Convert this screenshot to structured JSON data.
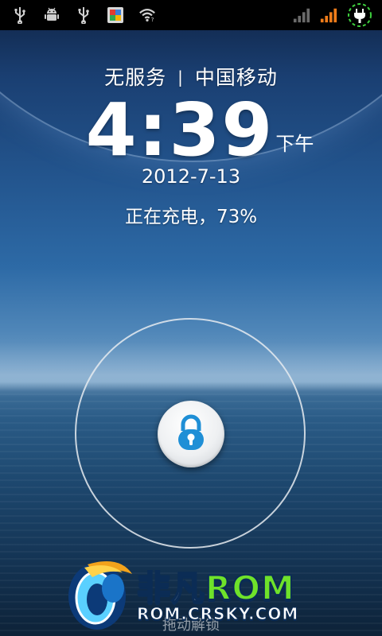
{
  "status_bar": {
    "left_icons": [
      "usb-icon",
      "android-debug-icon",
      "usb-icon",
      "app-notification-icon",
      "wifi-icon"
    ],
    "right_icons": [
      "signal-gray-icon",
      "signal-orange-icon",
      "charging-plug-icon"
    ],
    "colors": {
      "background": "#000000",
      "signal_active": "#f07c1a",
      "charging_ring": "#3ecf3e"
    }
  },
  "lockscreen": {
    "carrier_left": "无服务",
    "carrier_separator": "|",
    "carrier_right": "中国移动",
    "time": "4:39",
    "ampm": "下午",
    "date": "2012-7-13",
    "charging_status": "正在充电，73%",
    "lock_icon": "padlock-icon",
    "hint": "拖动解锁"
  },
  "watermark": {
    "brand_cn": "非凡",
    "brand_en": "ROM",
    "url": "ROM.CRSKY.COM",
    "logo": "crsky-logo"
  }
}
